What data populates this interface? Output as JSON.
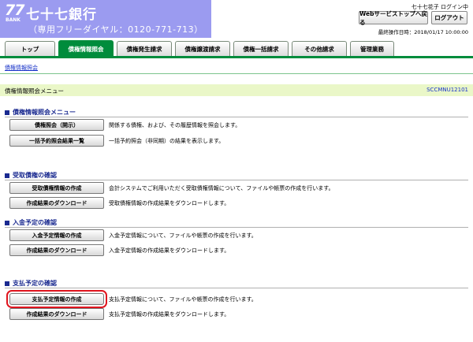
{
  "header": {
    "logo_number": "77",
    "logo_bank": "BANK",
    "bank_name": "七十七銀行",
    "tel": "（専用フリーダイヤル：0120-771-713）",
    "user_status": "七十七花子 ログイン中",
    "websvc_label": "Webサービストップへ戻る",
    "logout_label": "ログアウト",
    "last_operation": "最終操作日時：2018/01/17 10:00:00"
  },
  "tabs": [
    {
      "label": "トップ"
    },
    {
      "label": "債権情報照会"
    },
    {
      "label": "債権発生請求"
    },
    {
      "label": "債権譲渡請求"
    },
    {
      "label": "債権一括請求"
    },
    {
      "label": "その他請求"
    },
    {
      "label": "管理業務"
    }
  ],
  "subnav": {
    "label": "債権情報照会"
  },
  "screen": {
    "title": "債権情報照会メニュー",
    "id": "SCCMNU12101"
  },
  "sections": [
    {
      "title": "債権情報照会メニュー",
      "items": [
        {
          "button": "債権照会（開示）",
          "desc": "関係する債権、および、その履歴情報を照会します。"
        },
        {
          "button": "一括予約照会結果一覧",
          "desc": "一括予約照会（非同期）の結果を表示します。"
        }
      ]
    },
    {
      "title": "受取債権の確認",
      "items": [
        {
          "button": "受取債権情報の作成",
          "desc": "会計システムでご利用いただく受取債権情報について、ファイルや帳票の作成を行います。"
        },
        {
          "button": "作成結果のダウンロード",
          "desc": "受取債権情報の作成結果をダウンロードします。"
        }
      ]
    },
    {
      "title": "入金予定の確認",
      "items": [
        {
          "button": "入金予定情報の作成",
          "desc": "入金予定情報について、ファイルや帳票の作成を行います。"
        },
        {
          "button": "作成結果のダウンロード",
          "desc": "入金予定情報の作成結果をダウンロードします。"
        }
      ]
    },
    {
      "title": "支払予定の確認",
      "items": [
        {
          "button": "支払予定情報の作成",
          "desc": "支払予定情報について、ファイルや帳票の作成を行います。"
        },
        {
          "button": "作成結果のダウンロード",
          "desc": "支払予定情報の作成結果をダウンロードします。"
        }
      ]
    }
  ],
  "colors": {
    "brand_green": "#008c3c",
    "logo_purple": "#9b9bf0",
    "section_blue": "#1a2a90",
    "highlight_red": "#e0141e"
  }
}
